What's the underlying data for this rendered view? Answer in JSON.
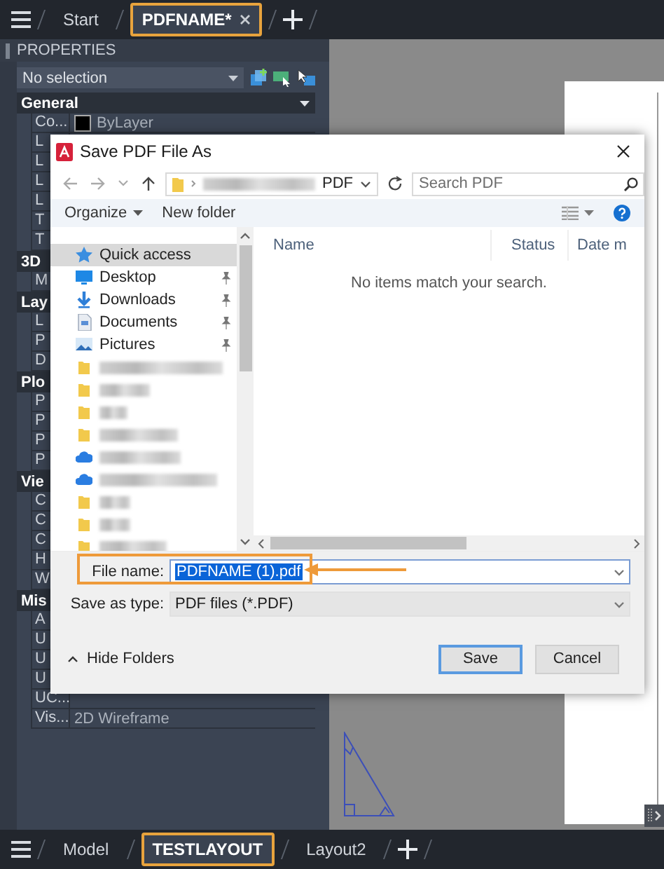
{
  "top_tabs": [
    {
      "label": "Start",
      "selected": false,
      "closable": false
    },
    {
      "label": "PDFNAME*",
      "selected": true,
      "closable": true
    }
  ],
  "properties": {
    "title": "PROPERTIES",
    "selection": "No selection",
    "sections": [
      {
        "title": "General",
        "expanded": true,
        "rows": [
          {
            "label": "Co...",
            "value": "ByLayer",
            "swatch": true
          },
          {
            "label": "L"
          },
          {
            "label": "L"
          },
          {
            "label": "L"
          },
          {
            "label": "L"
          },
          {
            "label": "T"
          },
          {
            "label": "T"
          }
        ]
      },
      {
        "title": "3D",
        "rows": [
          {
            "label": "M"
          }
        ]
      },
      {
        "title": "Lay",
        "rows": [
          {
            "label": "L"
          },
          {
            "label": "P"
          },
          {
            "label": "D"
          }
        ]
      },
      {
        "title": "Plo",
        "rows": [
          {
            "label": "P"
          },
          {
            "label": "P"
          },
          {
            "label": "P"
          },
          {
            "label": "P"
          }
        ]
      },
      {
        "title": "Vie",
        "rows": [
          {
            "label": "C"
          },
          {
            "label": "C"
          },
          {
            "label": "C"
          },
          {
            "label": "H"
          },
          {
            "label": "W"
          }
        ]
      },
      {
        "title": "Mis",
        "rows": [
          {
            "label": "A"
          },
          {
            "label": "U"
          },
          {
            "label": "U"
          },
          {
            "label": "U"
          },
          {
            "label": "UC..."
          },
          {
            "label": "Vis...",
            "value": "2D Wireframe"
          }
        ]
      }
    ]
  },
  "dialog": {
    "title": "Save PDF File As",
    "address": {
      "folder": "PDF"
    },
    "search": {
      "placeholder": "Search PDF"
    },
    "toolbar": {
      "organize": "Organize",
      "new_folder": "New folder"
    },
    "nav": [
      {
        "kind": "quick-access",
        "label": "Quick access",
        "selected": true,
        "pinned": false
      },
      {
        "kind": "desktop",
        "label": "Desktop",
        "selected": false,
        "pinned": true
      },
      {
        "kind": "downloads",
        "label": "Downloads",
        "selected": false,
        "pinned": true
      },
      {
        "kind": "documents",
        "label": "Documents",
        "selected": false,
        "pinned": true
      },
      {
        "kind": "pictures",
        "label": "Pictures",
        "selected": false,
        "pinned": true
      },
      {
        "kind": "folder",
        "selected": false,
        "pinned": false
      },
      {
        "kind": "folder",
        "selected": false,
        "pinned": false
      },
      {
        "kind": "folder",
        "selected": false,
        "pinned": false
      },
      {
        "kind": "folder",
        "selected": false,
        "pinned": false
      },
      {
        "kind": "cloud",
        "selected": false,
        "pinned": false
      },
      {
        "kind": "cloud",
        "selected": false,
        "pinned": false
      },
      {
        "kind": "folder",
        "selected": false,
        "pinned": false
      },
      {
        "kind": "folder",
        "selected": false,
        "pinned": false
      },
      {
        "kind": "folder",
        "selected": false,
        "pinned": false
      }
    ],
    "columns": [
      "Name",
      "Status",
      "Date m"
    ],
    "empty_message": "No items match your search.",
    "file_name": {
      "label": "File name:",
      "value": "PDFNAME (1).pdf",
      "highlighted": true,
      "callout_arrow": true
    },
    "save_as_type": {
      "label": "Save as type:",
      "value": "PDF files (*.PDF)"
    },
    "hide_folders": "Hide Folders",
    "buttons": [
      {
        "label": "Save",
        "default": true
      },
      {
        "label": "Cancel",
        "default": false
      }
    ]
  },
  "layout_tabs": [
    {
      "label": "Model",
      "selected": false
    },
    {
      "label": "TESTLAYOUT",
      "selected": true
    },
    {
      "label": "Layout2",
      "selected": false
    }
  ]
}
